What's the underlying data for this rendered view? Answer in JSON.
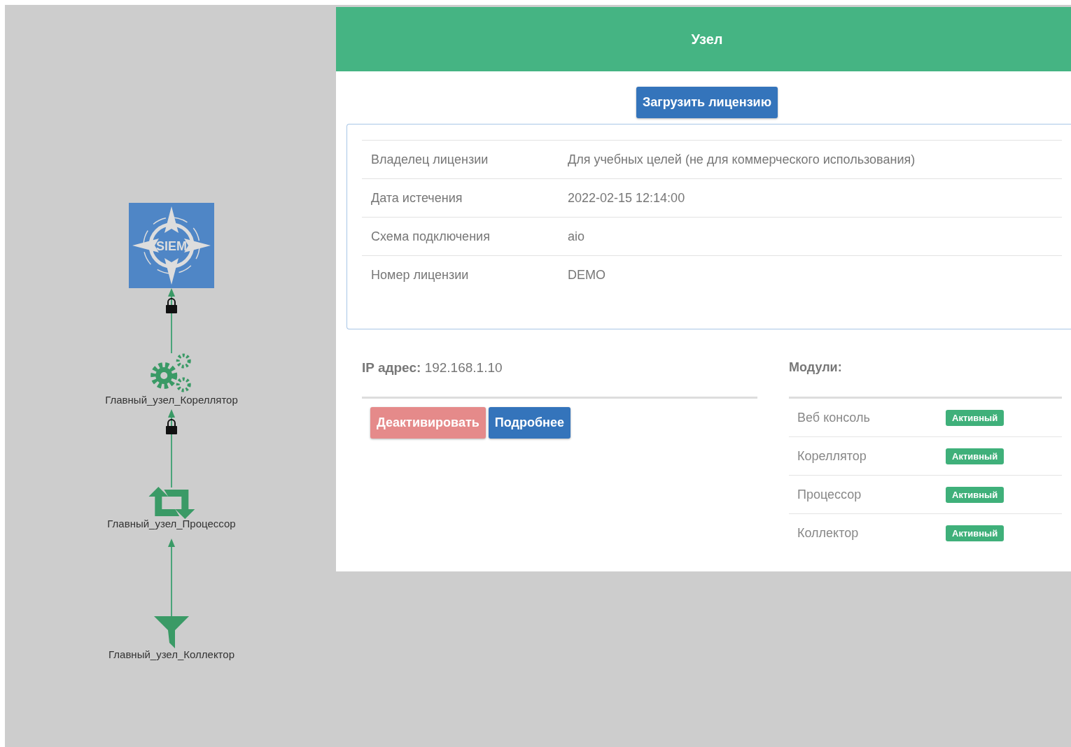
{
  "diagram": {
    "nodes": [
      {
        "kind": "siem",
        "label": "SIEM"
      },
      {
        "kind": "correlator",
        "label": "Главный_узел_Кореллятор"
      },
      {
        "kind": "processor",
        "label": "Главный_узел_Процессор"
      },
      {
        "kind": "collector",
        "label": "Главный_узел_Коллектор"
      }
    ],
    "edges": [
      {
        "locked": true
      },
      {
        "locked": true
      },
      {
        "locked": false
      }
    ]
  },
  "panel": {
    "title": "Узел",
    "upload_button": "Загрузить лицензию",
    "license": [
      {
        "label": "Владелец лицензии",
        "value": "Для учебных целей (не для коммерческого использования)"
      },
      {
        "label": "Дата истечения",
        "value": "2022-02-15 12:14:00"
      },
      {
        "label": "Схема подключения",
        "value": "aio"
      },
      {
        "label": "Номер лицензии",
        "value": "DEMO"
      }
    ],
    "ip": {
      "label": "IP адрес:",
      "value": "192.168.1.10"
    },
    "buttons": [
      {
        "kind": "danger",
        "label": "Деактивировать"
      },
      {
        "kind": "primary",
        "label": "Подробнее"
      }
    ],
    "modules_title": "Модули:",
    "modules": [
      {
        "name": "Веб консоль",
        "status": "Активный",
        "active": true
      },
      {
        "name": "Кореллятор",
        "status": "Активный",
        "active": true
      },
      {
        "name": "Процессор",
        "status": "Активный",
        "active": true
      },
      {
        "name": "Коллектор",
        "status": "Активный",
        "active": true
      }
    ]
  }
}
